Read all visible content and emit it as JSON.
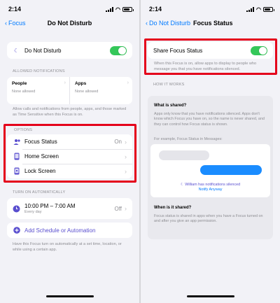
{
  "left": {
    "status_time": "2:14",
    "nav": {
      "back_label": "Focus",
      "title": "Do Not Disturb"
    },
    "dnd_label": "Do Not Disturb",
    "allowed_header": "ALLOWED NOTIFICATIONS",
    "people": {
      "title": "People",
      "subtitle": "None allowed"
    },
    "apps": {
      "title": "Apps",
      "subtitle": "None allowed"
    },
    "allowed_footnote": "Allow calls and notifications from people, apps, and those marked as Time Sensitive when this Focus is on.",
    "options_header": "OPTIONS",
    "options": [
      {
        "label": "Focus Status",
        "value": "On",
        "icon": "focus-status-icon"
      },
      {
        "label": "Home Screen",
        "value": "",
        "icon": "home-screen-icon"
      },
      {
        "label": "Lock Screen",
        "value": "",
        "icon": "lock-screen-icon"
      }
    ],
    "auto_header": "TURN ON AUTOMATICALLY",
    "schedule": {
      "time": "10:00 PM – 7:00 AM",
      "days": "Every day",
      "value": "Off"
    },
    "add_label": "Add Schedule or Automation",
    "auto_footnote": "Have this Focus turn on automatically at a set time, location, or while using a certain app."
  },
  "right": {
    "status_time": "2:14",
    "nav": {
      "back_label": "Do Not Disturb",
      "title": "Focus Status"
    },
    "share_label": "Share Focus Status",
    "share_description": "When this Focus is on, allow apps to display to people who message you that you have notifications silenced.",
    "how_header": "HOW IT WORKS",
    "what_title": "What is shared?",
    "what_text": "Apps only know that you have notifications silenced. Apps don't know which Focus you have on, so the name is never shared, and they can control how Focus status is shown.",
    "example_text": "For example, Focus Status in Messages:",
    "silenced_note": "William has notifications silenced",
    "notify_anyway": "Notify Anyway",
    "when_title": "When is it shared?",
    "when_text": "Focus status is shared in apps when you have a Focus turned on and after you give an app permission."
  },
  "colors": {
    "accent": "#007aff",
    "toggle_on": "#34c759",
    "focus_purple": "#5a4fcf",
    "highlight": "#e4001b"
  }
}
